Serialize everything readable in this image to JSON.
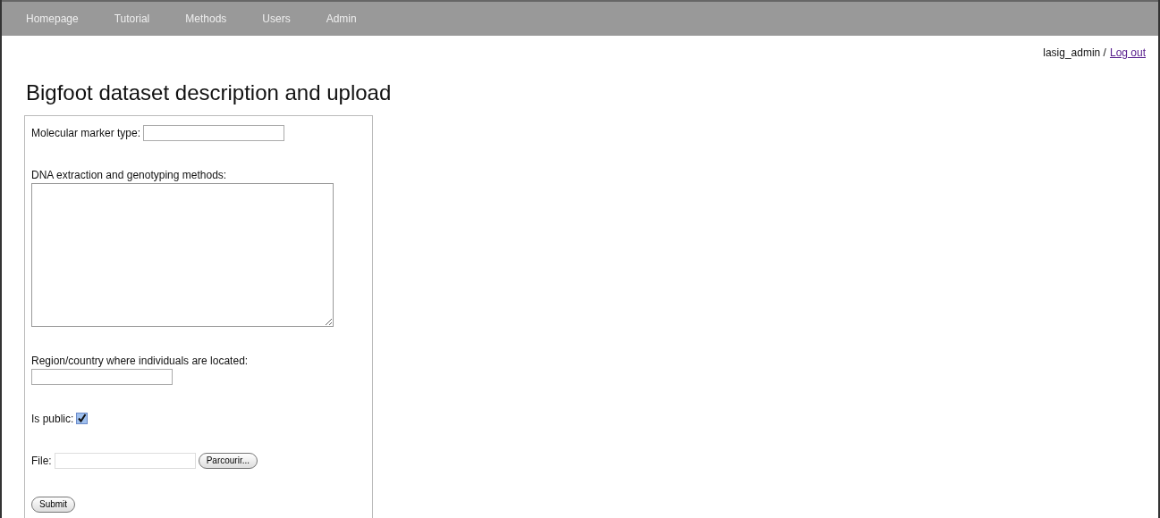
{
  "nav": [
    {
      "label": "Homepage"
    },
    {
      "label": "Tutorial"
    },
    {
      "label": "Methods"
    },
    {
      "label": "Users"
    },
    {
      "label": "Admin"
    }
  ],
  "user": {
    "name": "lasig_admin /",
    "logout": "Log out"
  },
  "title": "Bigfoot dataset description and upload",
  "form": {
    "fields": [
      {
        "kind": "inline_text",
        "label": "Molecular marker type:"
      },
      {
        "kind": "textarea",
        "label": "DNA extraction and genotyping methods:"
      },
      {
        "kind": "block_text",
        "label": "Region/country where individuals are located:"
      },
      {
        "kind": "checkbox",
        "label": "Is public:",
        "checked": true
      },
      {
        "kind": "file",
        "label": "File:",
        "button": "Parcourir..."
      }
    ],
    "submit": "Submit"
  }
}
